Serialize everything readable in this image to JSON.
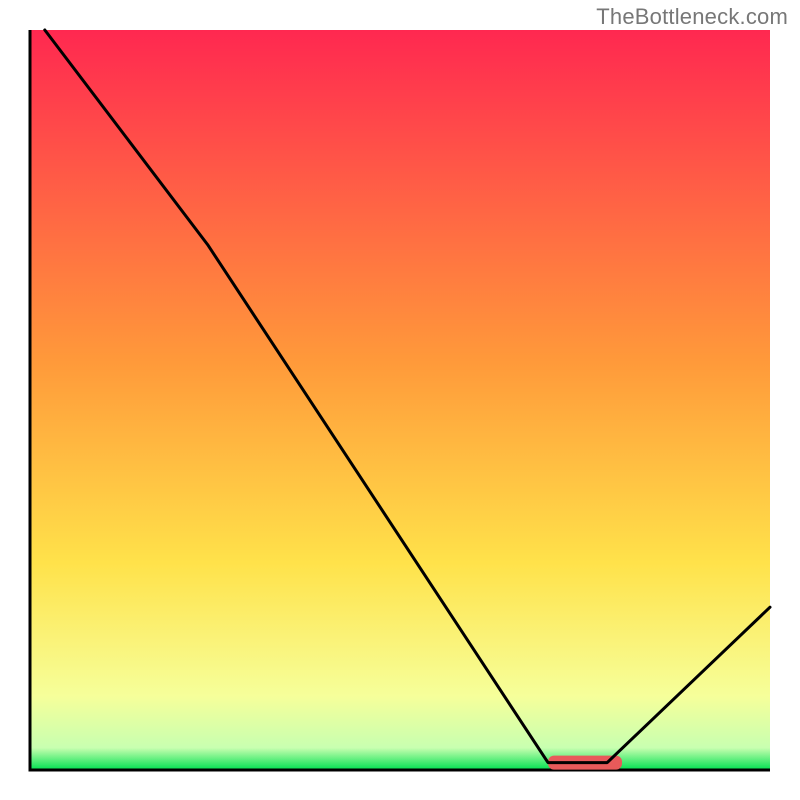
{
  "watermark": "TheBottleneck.com",
  "chart_data": {
    "type": "line",
    "title": "",
    "xlabel": "",
    "ylabel": "",
    "xlim": [
      0,
      100
    ],
    "ylim": [
      0,
      100
    ],
    "curve_points": [
      {
        "x": 2,
        "y": 100
      },
      {
        "x": 24,
        "y": 71
      },
      {
        "x": 70,
        "y": 1
      },
      {
        "x": 78,
        "y": 1
      },
      {
        "x": 100,
        "y": 22
      }
    ],
    "marker": {
      "x_start": 70,
      "x_end": 80,
      "y": 1
    },
    "gradient_stops": [
      {
        "offset": 0.0,
        "color": "#ff2850"
      },
      {
        "offset": 0.45,
        "color": "#ff9a3a"
      },
      {
        "offset": 0.72,
        "color": "#ffe24a"
      },
      {
        "offset": 0.9,
        "color": "#f6ff9a"
      },
      {
        "offset": 0.97,
        "color": "#c8ffb0"
      },
      {
        "offset": 1.0,
        "color": "#00e050"
      }
    ],
    "axes_visible": true,
    "grid": false
  }
}
